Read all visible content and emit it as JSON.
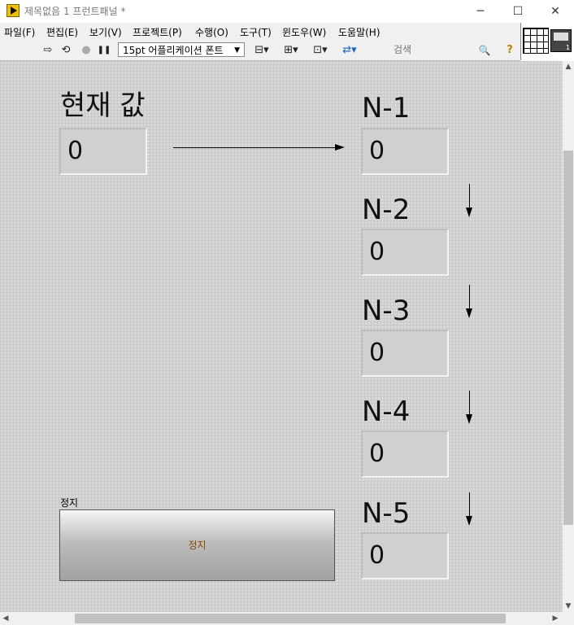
{
  "window": {
    "title": "제목없음 1 프런트패널 *",
    "minimize": "─",
    "maximize": "☐",
    "close": "✕"
  },
  "menu": [
    "파일(F)",
    "편집(E)",
    "보기(V)",
    "프로젝트(P)",
    "수행(O)",
    "도구(T)",
    "윈도우(W)",
    "도움말(H)"
  ],
  "toolbar": {
    "font": "15pt 어플리케이션 폰트",
    "font_caret": "▼",
    "search_placeholder": "검색",
    "help": "?",
    "icons": {
      "run": "⇨",
      "run_continuously": "⟲",
      "abort": "●",
      "pause": "❚❚",
      "align": "⊟▾",
      "distribute": "⊞▾",
      "resize": "⊡▾",
      "reorder": "⇄▾",
      "search": "🔍"
    }
  },
  "vi_icon_number": "1",
  "panel": {
    "current_label": "현재 값",
    "current_value": "0",
    "items": [
      {
        "label": "N-1",
        "value": "0"
      },
      {
        "label": "N-2",
        "value": "0"
      },
      {
        "label": "N-3",
        "value": "0"
      },
      {
        "label": "N-4",
        "value": "0"
      },
      {
        "label": "N-5",
        "value": "0"
      }
    ],
    "stop_label": "정지",
    "stop_button": "정지"
  },
  "scroll": {
    "up": "▲",
    "down": "▼",
    "left": "◀",
    "right": "▶"
  }
}
